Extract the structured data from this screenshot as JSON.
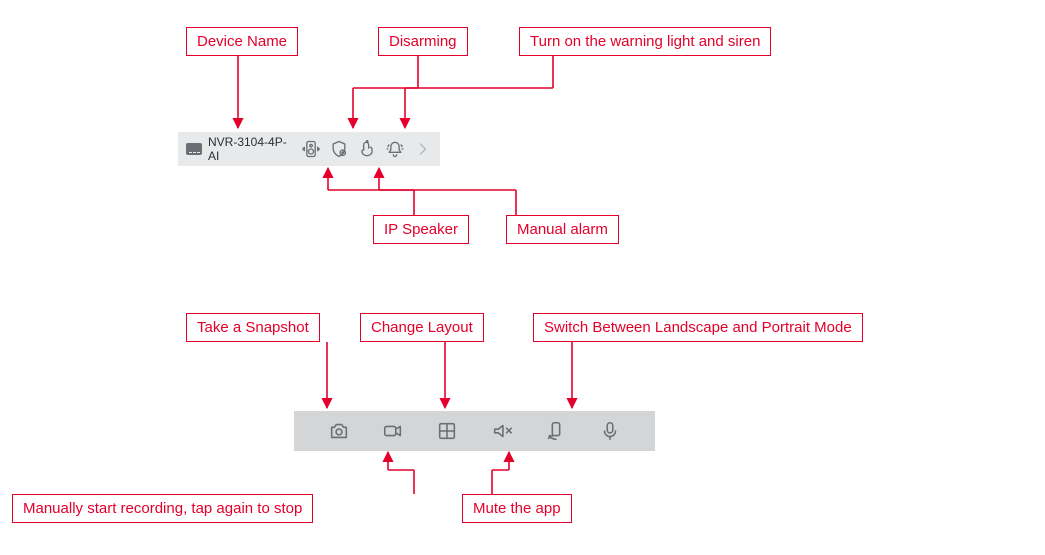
{
  "top_toolbar": {
    "device_name": "NVR-3104-4P-AI"
  },
  "callouts_top": {
    "device_name": "Device Name",
    "disarming": "Disarming",
    "warning_light_siren": "Turn on the warning light and siren",
    "ip_speaker": "IP Speaker",
    "manual_alarm": "Manual alarm"
  },
  "callouts_bottom": {
    "snapshot": "Take a Snapshot",
    "change_layout": "Change Layout",
    "switch_orientation": "Switch Between Landscape and Portrait Mode",
    "start_recording": "Manually start recording, tap again to stop",
    "mute_app": "Mute the app"
  }
}
